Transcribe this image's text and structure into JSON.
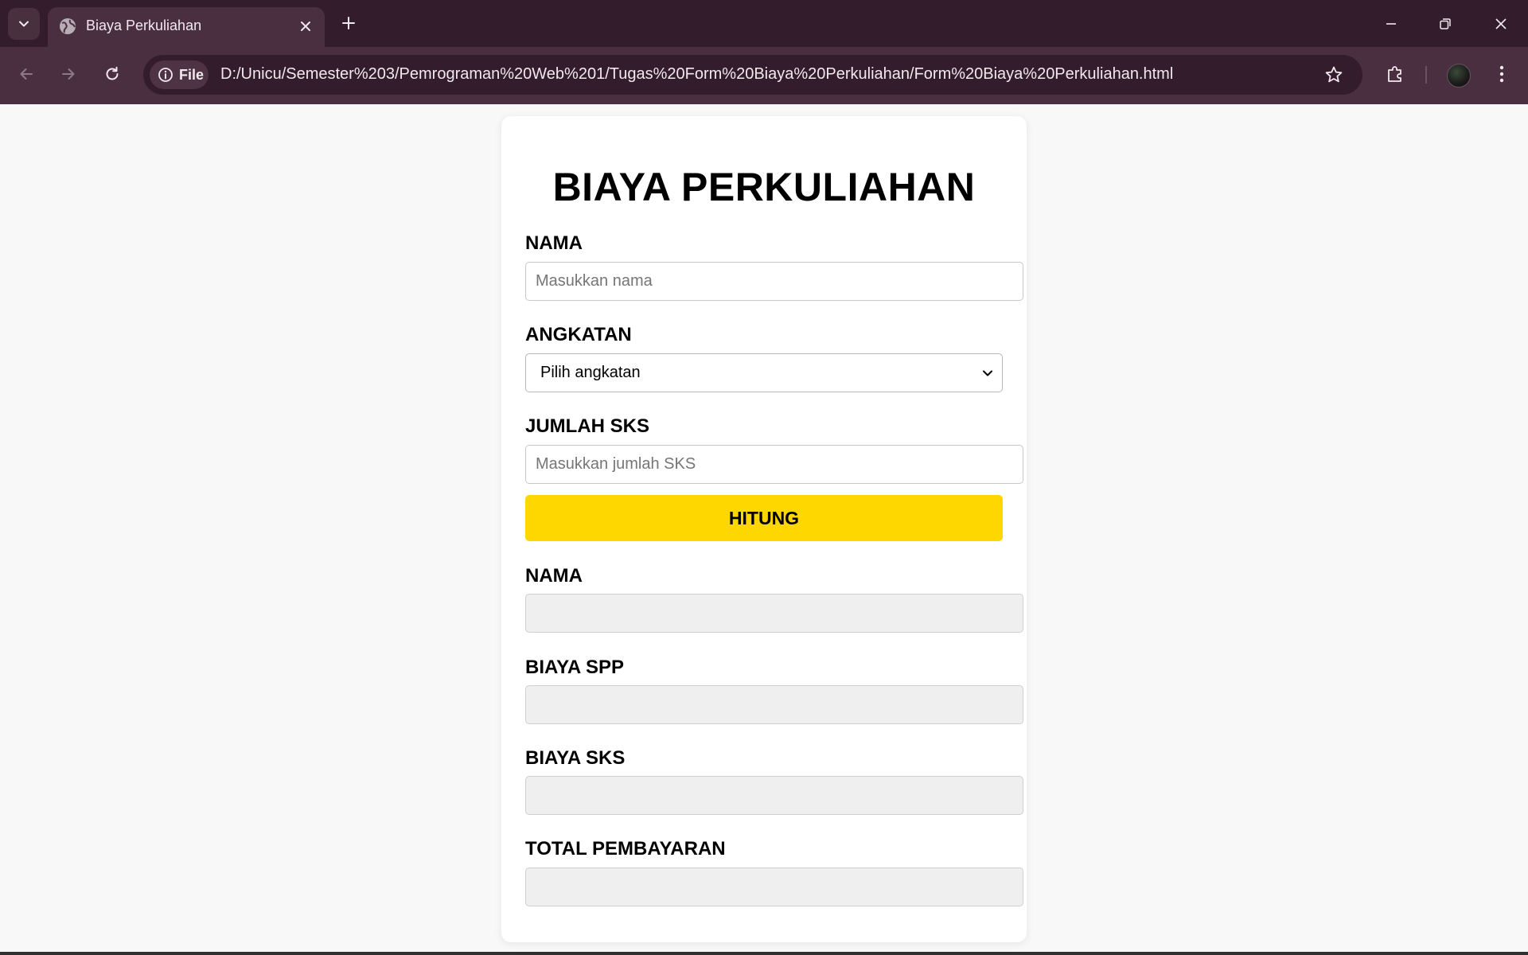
{
  "browser": {
    "tab_title": "Biaya Perkuliahan",
    "site_chip": "File",
    "url": "D:/Unicu/Semester%203/Pemrograman%20Web%201/Tugas%20Form%20Biaya%20Perkuliahan/Form%20Biaya%20Perkuliahan.html",
    "icons": [
      "tab-search-icon",
      "globe-icon",
      "close-icon",
      "plus-icon",
      "minimize-icon",
      "restore-icon",
      "window-close-icon",
      "back-icon",
      "forward-icon",
      "reload-icon",
      "info-icon",
      "star-icon",
      "extensions-icon",
      "profile-avatar",
      "menu-icon"
    ]
  },
  "form": {
    "title": "BIAYA PERKULIAHAN",
    "nama_label": "NAMA",
    "nama_placeholder": "Masukkan nama",
    "angkatan_label": "ANGKATAN",
    "angkatan_selected": "Pilih angkatan",
    "sks_label": "JUMLAH SKS",
    "sks_placeholder": "Masukkan jumlah SKS",
    "hitung_label": "HITUNG"
  },
  "result": {
    "nama_label": "NAMA",
    "spp_label": "BIAYA SPP",
    "sks_label": "BIAYA SKS",
    "total_label": "TOTAL PEMBAYARAN"
  },
  "colors": {
    "browser_frame": "#331c2b",
    "toolbar": "#4a2f40",
    "button_accent": "#ffd700",
    "readonly_field": "#efefef",
    "page_bg": "#f8f8f8"
  }
}
